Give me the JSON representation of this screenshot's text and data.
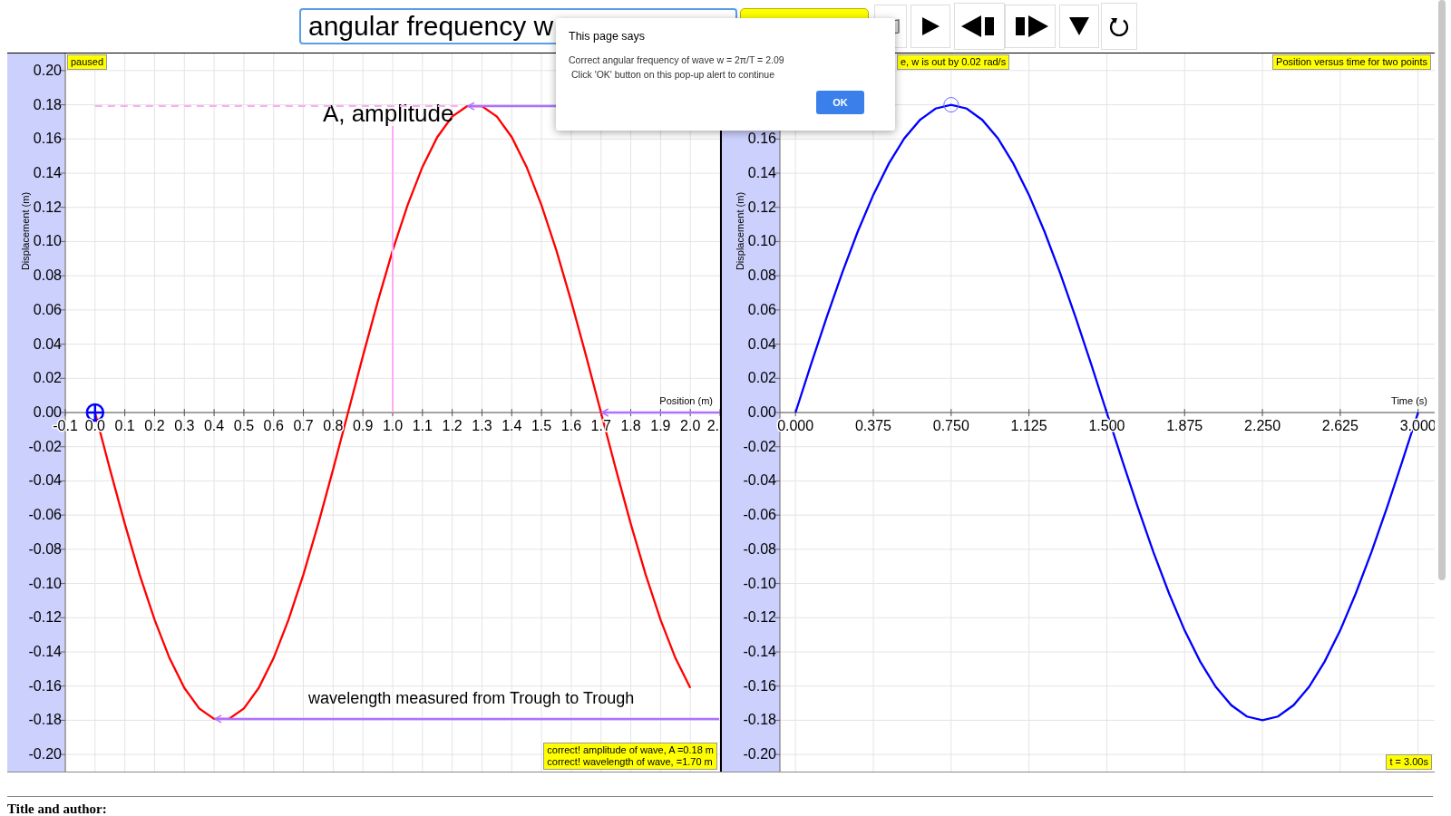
{
  "toolbar": {
    "quantity_select": {
      "value": "angular frequency w"
    },
    "buttons": [
      {
        "kind": "book"
      },
      {
        "kind": "play"
      },
      {
        "kind": "step-back"
      },
      {
        "kind": "step-forward"
      },
      {
        "kind": "down"
      },
      {
        "kind": "reset"
      }
    ]
  },
  "panels": [
    {
      "status": "paused",
      "feedback": [
        "correct! amplitude of wave, A =0.18 m",
        "correct! wavelength of wave, =1.70 m"
      ],
      "chart_data": {
        "type": "line",
        "xlabel": "Position (m)",
        "ylabel": "Displacement (m)",
        "xlim": [
          -0.1,
          2.1
        ],
        "ylim": [
          -0.21,
          0.21
        ],
        "xticks": [
          -0.1,
          {
            "value": 0,
            "label": "0.0"
          },
          0.1,
          0.2,
          0.3,
          0.4,
          0.5,
          0.6,
          0.7,
          0.8,
          0.9,
          {
            "value": 1,
            "label": "1.0"
          },
          1.1,
          1.2,
          1.3,
          1.4,
          1.5,
          1.6,
          1.7,
          1.8,
          1.9,
          {
            "value": 2,
            "label": "2.0"
          },
          {
            "value": 2.1,
            "label": "2."
          }
        ],
        "yticks": [
          {
            "value": -0.2,
            "label": "-0.20"
          },
          {
            "value": -0.18,
            "label": "-0.18"
          },
          {
            "value": -0.16,
            "label": "-0.16"
          },
          {
            "value": -0.14,
            "label": "-0.14"
          },
          {
            "value": -0.12,
            "label": "-0.12"
          },
          {
            "value": -0.1,
            "label": "-0.10"
          },
          {
            "value": -0.08,
            "label": "-0.08"
          },
          {
            "value": -0.06,
            "label": "-0.06"
          },
          {
            "value": -0.04,
            "label": "-0.04"
          },
          {
            "value": -0.02,
            "label": "-0.02"
          },
          {
            "value": 0,
            "label": "0.00"
          },
          {
            "value": 0.02,
            "label": "0.02"
          },
          {
            "value": 0.04,
            "label": "0.04"
          },
          {
            "value": 0.06,
            "label": "0.06"
          },
          {
            "value": 0.08,
            "label": "0.08"
          },
          {
            "value": 0.1,
            "label": "0.10"
          },
          {
            "value": 0.12,
            "label": "0.12"
          },
          {
            "value": 0.14,
            "label": "0.14"
          },
          {
            "value": 0.16,
            "label": "0.16"
          },
          {
            "value": 0.18,
            "label": "0.18"
          },
          {
            "value": 0.2,
            "label": "0.20"
          }
        ],
        "x": [
          0,
          0.05,
          0.1,
          0.15,
          0.2,
          0.25,
          0.3,
          0.35,
          0.4,
          0.45,
          0.5,
          0.55,
          0.6,
          0.65,
          0.7,
          0.75,
          0.8,
          0.85,
          0.9,
          0.95,
          1,
          1.05,
          1.1,
          1.15,
          1.2,
          1.25,
          1.3,
          1.35,
          1.4,
          1.45,
          1.5,
          1.55,
          1.6,
          1.65,
          1.7,
          1.75,
          1.8,
          1.85,
          1.9,
          1.95,
          2
        ],
        "series": [
          {
            "color": "#ff0000",
            "values": [
              0,
              -0.0331,
              -0.065,
              -0.0948,
              -0.1213,
              -0.1436,
              -0.1611,
              -0.1731,
              -0.1792,
              -0.1792,
              -0.1731,
              -0.1611,
              -0.1436,
              -0.1213,
              -0.0948,
              -0.065,
              -0.0331,
              0,
              0.0331,
              0.065,
              0.0948,
              0.1213,
              0.1436,
              0.1611,
              0.1731,
              0.1792,
              0.1792,
              0.1731,
              0.1611,
              0.1436,
              0.1213,
              0.0948,
              0.065,
              0.0331,
              0,
              -0.0331,
              -0.065,
              -0.0948,
              -0.1213,
              -0.1436,
              -0.1611
            ]
          }
        ],
        "grid": true,
        "annotations": [
          "A, amplitude",
          "wavelength measured from Trough to Trough"
        ]
      }
    },
    {
      "hint": "e, w is out by 0.02 rad/s",
      "title": "Position versus time for two points",
      "time": "t = 3.00s",
      "chart_data": {
        "type": "line",
        "xlabel": "Time (s)",
        "ylabel": "Displacement (m)",
        "xlim": [
          -0.075,
          3.08
        ],
        "ylim": [
          -0.21,
          0.21
        ],
        "xticks": [
          {
            "value": 0,
            "label": "0.000"
          },
          {
            "value": 0.375,
            "label": "0.375"
          },
          {
            "value": 0.75,
            "label": "0.750"
          },
          {
            "value": 1.125,
            "label": "1.125"
          },
          {
            "value": 1.5,
            "label": "1.500"
          },
          {
            "value": 1.875,
            "label": "1.875"
          },
          {
            "value": 2.25,
            "label": "2.250"
          },
          {
            "value": 2.625,
            "label": "2.625"
          },
          {
            "value": 3,
            "label": "3.000"
          }
        ],
        "yticks": [
          {
            "value": -0.2,
            "label": "-0.20"
          },
          {
            "value": -0.18,
            "label": "-0.18"
          },
          {
            "value": -0.16,
            "label": "-0.16"
          },
          {
            "value": -0.14,
            "label": "-0.14"
          },
          {
            "value": -0.12,
            "label": "-0.12"
          },
          {
            "value": -0.1,
            "label": "-0.10"
          },
          {
            "value": -0.08,
            "label": "-0.08"
          },
          {
            "value": -0.06,
            "label": "-0.06"
          },
          {
            "value": -0.04,
            "label": "-0.04"
          },
          {
            "value": -0.02,
            "label": "-0.02"
          },
          {
            "value": 0,
            "label": "0.00"
          },
          {
            "value": 0.02,
            "label": "0.02"
          },
          {
            "value": 0.04,
            "label": "0.04"
          },
          {
            "value": 0.06,
            "label": "0.06"
          },
          {
            "value": 0.08,
            "label": "0.08"
          },
          {
            "value": 0.1,
            "label": "0.10"
          },
          {
            "value": 0.12,
            "label": "0.12"
          },
          {
            "value": 0.14,
            "label": "0.14"
          },
          {
            "value": 0.16,
            "label": "0.16"
          }
        ],
        "x": [
          0,
          0.075,
          0.15,
          0.225,
          0.3,
          0.375,
          0.45,
          0.525,
          0.6,
          0.675,
          0.75,
          0.825,
          0.9,
          0.975,
          1.05,
          1.125,
          1.2,
          1.275,
          1.35,
          1.425,
          1.5,
          1.575,
          1.65,
          1.725,
          1.8,
          1.875,
          1.95,
          2.025,
          2.1,
          2.175,
          2.25,
          2.325,
          2.4,
          2.475,
          2.55,
          2.625,
          2.7,
          2.775,
          2.85,
          2.925,
          3
        ],
        "series": [
          {
            "color": "#0000ff",
            "values": [
              0,
              0.0282,
              0.0556,
              0.0817,
              0.1058,
              0.1273,
              0.1456,
              0.1604,
              0.1712,
              0.1778,
              0.18,
              0.1778,
              0.1712,
              0.1604,
              0.1456,
              0.1273,
              0.1058,
              0.0817,
              0.0556,
              0.0282,
              0,
              -0.0282,
              -0.0556,
              -0.0817,
              -0.1058,
              -0.1273,
              -0.1456,
              -0.1604,
              -0.1712,
              -0.1778,
              -0.18,
              -0.1778,
              -0.1712,
              -0.1604,
              -0.1456,
              -0.1273,
              -0.1058,
              -0.0817,
              -0.0556,
              -0.0282,
              0
            ]
          }
        ],
        "grid": true
      }
    }
  ],
  "alert": {
    "heading": "This page says",
    "lines": [
      "Correct angular frequency of wave w = 2π/T = 2.09",
      "Click 'OK' button on this pop-up alert to continue"
    ],
    "button": "OK"
  },
  "footer": {
    "heading": "Title and author:"
  }
}
